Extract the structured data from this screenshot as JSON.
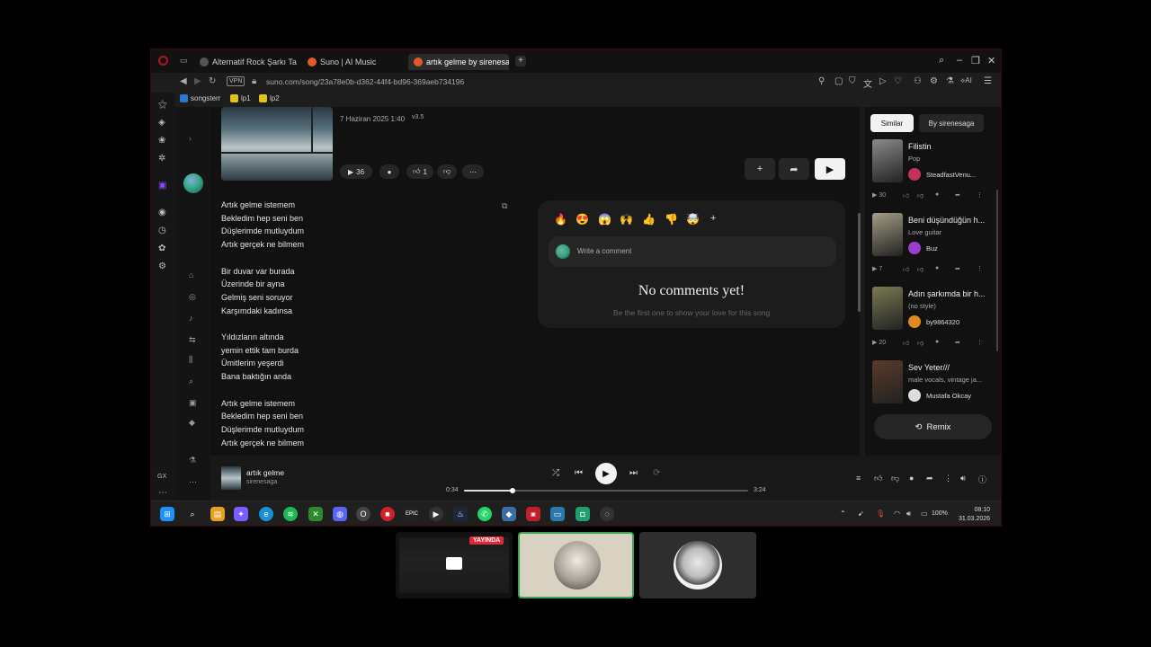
{
  "browser": {
    "tabs": [
      {
        "title": "Alternatif Rock Şarkı Taslağ",
        "color": "#444"
      },
      {
        "title": "Suno | AI Music",
        "color": "#e0592a"
      },
      {
        "title": "artık gelme by sirenesaga",
        "color": "#e0592a"
      }
    ],
    "new_tab": "+",
    "vpn": "VPN",
    "url": "suno.com/song/23a78e0b-d362-44f4-bd96-369aeb734196",
    "bookmarks": [
      "songsterr",
      "lp1",
      "lp2"
    ]
  },
  "song": {
    "date": "7 Haziran 2025 1:40",
    "version": "v3.5",
    "plays": "36",
    "likes": "1"
  },
  "lyrics": [
    "Artık gelme istemem",
    "Bekledim hep seni ben",
    "Düşlerimde mutluydum",
    "Artık gerçek ne bilmem",
    "",
    "Bir duvar var burada",
    "Üzerinde bir ayna",
    "Gelmiş seni soruyor",
    "Karşımdaki kadınsa",
    "",
    "Yıldızların altında",
    " yemin ettik tam burda",
    "Ümitlerim yeşerdi",
    "Bana baktığın anda",
    "",
    "Artık gelme istemem",
    "Bekledim hep seni ben",
    "Düşlerimde mutluydum",
    "Artık gerçek ne bilmem"
  ],
  "comments": {
    "emojis": [
      "🔥",
      "😍",
      "😱",
      "🙌",
      "👍",
      "👎",
      "🤯"
    ],
    "placeholder": "Write a comment",
    "empty_title": "No comments yet!",
    "empty_sub": "Be the first one to show your love for this song"
  },
  "right_panel": {
    "tabs": [
      "Similar",
      "By sirenesaga"
    ],
    "songs": [
      {
        "title": "Filistin",
        "style": "Pop",
        "artist": "SteadfastVenu...",
        "plays": "30",
        "thumb": "#8a8a8a",
        "dot": "#c0335a"
      },
      {
        "title": "Beni düşündüğün h...",
        "style": "Love guitar",
        "artist": "Buz",
        "plays": "7",
        "thumb": "#a59c86",
        "dot": "#9a3fd0"
      },
      {
        "title": "Adın şarkımda bir h...",
        "style": "(no style)",
        "artist": "by9864320",
        "plays": "20",
        "thumb": "#7a7a52",
        "dot": "#e08a20"
      },
      {
        "title": "Sev Yeter///",
        "style": "male vocals, vintage ja...",
        "artist": "Mustafa Okcay",
        "plays": "",
        "thumb": "#5a3a2a",
        "dot": "#ddd"
      }
    ],
    "remix": "Remix"
  },
  "player": {
    "title": "artık gelme",
    "artist": "sirenesaga",
    "current": "0:34",
    "total": "3:24",
    "progress": 0.17
  },
  "taskbar": {
    "battery": "100%",
    "time": "08:10",
    "date": "31.03.2026"
  },
  "call": {
    "live": "YAYINDA"
  },
  "colors": {
    "accent_live": "#e0283b",
    "active_border": "#3fa35a",
    "opera_red": "#e01e2e"
  }
}
